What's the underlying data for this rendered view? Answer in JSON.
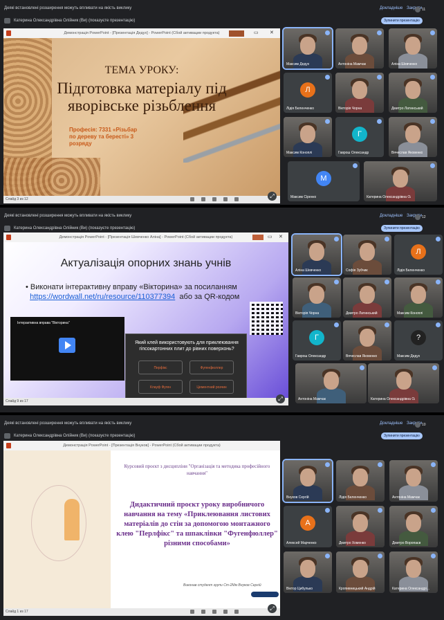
{
  "common": {
    "extension_notice": "Деякі встановлені розширення можуть впливати на якість виклику",
    "details_btn": "Докладніше",
    "close_btn": "Закрити",
    "stop_presenting_btn": "Зупинити презентацію"
  },
  "panels": [
    {
      "presenter": "Катерина Олександрівна Олійник (Ви) (показуєте презентацію)",
      "participant_count": "11",
      "ppt_title": "Демонстрація PowerPoint - [Презентація Дедух] - PowerPoint (Сбой активации продукта)",
      "status": "Слайд 3 из 12",
      "slide": {
        "title1": "ТЕМА УРОКУ:",
        "title2": "Підготовка матеріалу під яворівське різьблення",
        "profession": "Професія: 7331 «Різьбар по дереву та бересті» 3 розряду"
      },
      "tiles": [
        {
          "name": "Максим Дедух",
          "type": "cam",
          "active": true
        },
        {
          "name": "Антоніна Мамчак",
          "type": "cam"
        },
        {
          "name": "Аліна Шевченко",
          "type": "cam"
        },
        {
          "name": "Лідія Беленченко",
          "type": "avatar",
          "letter": "Л",
          "color": "#e8711a"
        },
        {
          "name": "Вікторія Чорна",
          "type": "cam"
        },
        {
          "name": "Дмитро Латинський",
          "type": "cam"
        },
        {
          "name": "Максим Коноплі",
          "type": "cam"
        },
        {
          "name": "Гаврош Олександр",
          "type": "avatar",
          "letter": "Г",
          "color": "#12b5cb"
        },
        {
          "name": "Вячеслав Яковенко",
          "type": "cam"
        },
        {
          "name": "Максим Сіренко",
          "type": "avatar",
          "letter": "М",
          "color": "#4285f4"
        },
        {
          "name": "Катерина Олександрівна Олійник",
          "type": "cam"
        }
      ]
    },
    {
      "presenter": "Катерина Олександрівна Олійник (Ви) (показуєте презентацію)",
      "participant_count": "12",
      "ppt_title": "Демонстрація PowerPoint - [Презентація Шевченко Аліна] - PowerPoint (Сбой активации продукта)",
      "status": "Слайд 9 из 17",
      "slide": {
        "title": "Актуалізація опорних знань учнів",
        "bullet": "Виконати інтерактивну вправу «Вікторина» за посиланням",
        "link": "https://wordwall.net/ru/resource/110377394",
        "after_link": "або за QR-кодом",
        "video_title": "Інтерактивна вправа \"Вікторина\"",
        "quiz_question": "Який клей використовують для приклеювання гіпсокартонних плит до рівних поверхонь?",
        "options": [
          "Перфікс",
          "Фугенфюллер",
          "Клауф Фуген",
          "Цементний розчин"
        ]
      },
      "tiles": [
        {
          "name": "Аліна Шевченко",
          "type": "cam",
          "active": true
        },
        {
          "name": "Софія Зубчик",
          "type": "cam"
        },
        {
          "name": "Лідія Беленченко",
          "type": "avatar",
          "letter": "Л",
          "color": "#e8711a"
        },
        {
          "name": "Вікторія Чорна",
          "type": "cam"
        },
        {
          "name": "Дмитро Латинський",
          "type": "cam"
        },
        {
          "name": "Максим Коноплі",
          "type": "cam"
        },
        {
          "name": "Гаврош Олександр",
          "type": "avatar",
          "letter": "Г",
          "color": "#12b5cb"
        },
        {
          "name": "Вячеслав Яковенко",
          "type": "cam"
        },
        {
          "name": "Максим Дедух",
          "type": "avatar",
          "letter": "?",
          "color": "#222"
        },
        {
          "name": "Антоніна Мамчак",
          "type": "cam"
        },
        {
          "name": "Катерина Олександрівна Олійник",
          "type": "cam"
        }
      ]
    },
    {
      "presenter": "Катерина Олександрівна Олійник (Ви) (показуєте презентацію)",
      "participant_count": "10",
      "ppt_title": "Демонстрація PowerPoint - [Презентація Внуков] - PowerPoint (Сбой активации продукта)",
      "status": "Слайд 1 из 17",
      "slide": {
        "sub": "Курсовий проєкт з дисципліни \"Організація та методика професійного навчання\"",
        "main": "Дидактичний проєкт уроку виробничого навчання на тему «Приклеювання листових матеріалів до стін за допомогою монтажного клею \"Перлфікс\" та шпаклівки \"Фугенфюллер\" різними способами»",
        "author": "Виконав студент групи Ст-2Мм Внуков Сергій"
      },
      "tiles": [
        {
          "name": "Внуков Сергій",
          "type": "cam",
          "active": true
        },
        {
          "name": "Лідія Беленченко",
          "type": "cam"
        },
        {
          "name": "Антоніна Мамчак",
          "type": "cam"
        },
        {
          "name": "Алексей Марченко",
          "type": "avatar",
          "letter": "А",
          "color": "#e8711a"
        },
        {
          "name": "Дмитро Хоменко",
          "type": "cam"
        },
        {
          "name": "Дмитро Воропаєв",
          "type": "cam"
        },
        {
          "name": "Віктор Цибулько",
          "type": "cam"
        },
        {
          "name": "Кропивницький Андрій",
          "type": "cam"
        },
        {
          "name": "Катерина Олександрі...",
          "type": "cam"
        }
      ]
    }
  ]
}
